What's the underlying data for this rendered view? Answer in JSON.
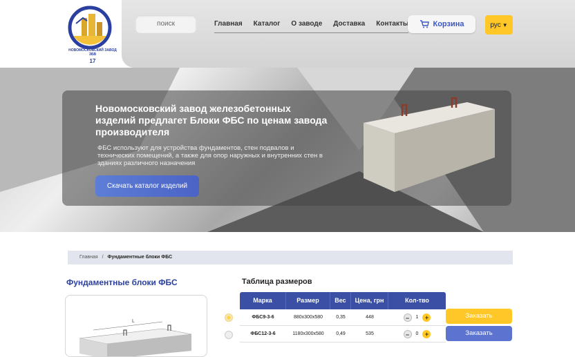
{
  "header": {
    "logo_text": "НОВОМОСКОВСКИЙ ЗАВОД ЗБВ",
    "logo_number": "17",
    "search_placeholder": "поиск",
    "nav": [
      "Главная",
      "Каталог",
      "О заводе",
      "Доставка",
      "Контакты"
    ],
    "cart_label": "Корзина",
    "language": "рус",
    "icons": {
      "cart": "cart-icon",
      "lang": "caret-down-icon"
    },
    "colors": {
      "accent": "#ffc728",
      "brand": "#3b4fa4"
    }
  },
  "hero": {
    "title": "Новомосковский завод железобетонных изделий предлагет Блоки ФБС по ценам завода производителя",
    "text": "ФБС используют для устройства фундаментов, стен подвалов и технических помещений, а также для опор наружных и внутренних стен в зданиях различного назначения",
    "button": "Скачать каталог изделий"
  },
  "breadcrumb": {
    "home": "Главная",
    "separator": "/",
    "current": "Фундаментные блоки ФБС"
  },
  "product": {
    "title": "Фундаментные блоки ФБС",
    "image_label": "L"
  },
  "table": {
    "title": "Таблица размеров",
    "headers": [
      "Марка",
      "Размер",
      "Вес",
      "Цена, грн",
      "Кол-тво"
    ],
    "rows": [
      {
        "mark": "ФБС9-3-6",
        "size": "880х300х580",
        "weight": "0,35",
        "price": "448",
        "qty": "1",
        "selected": true,
        "order": "Заказать",
        "order_color": "#ffc728"
      },
      {
        "mark": "ФБС12-3-6",
        "size": "1180х300х580",
        "weight": "0,49",
        "price": "535",
        "qty": "0",
        "selected": false,
        "order": "Заказать",
        "order_color": "#5c74d0"
      }
    ]
  }
}
